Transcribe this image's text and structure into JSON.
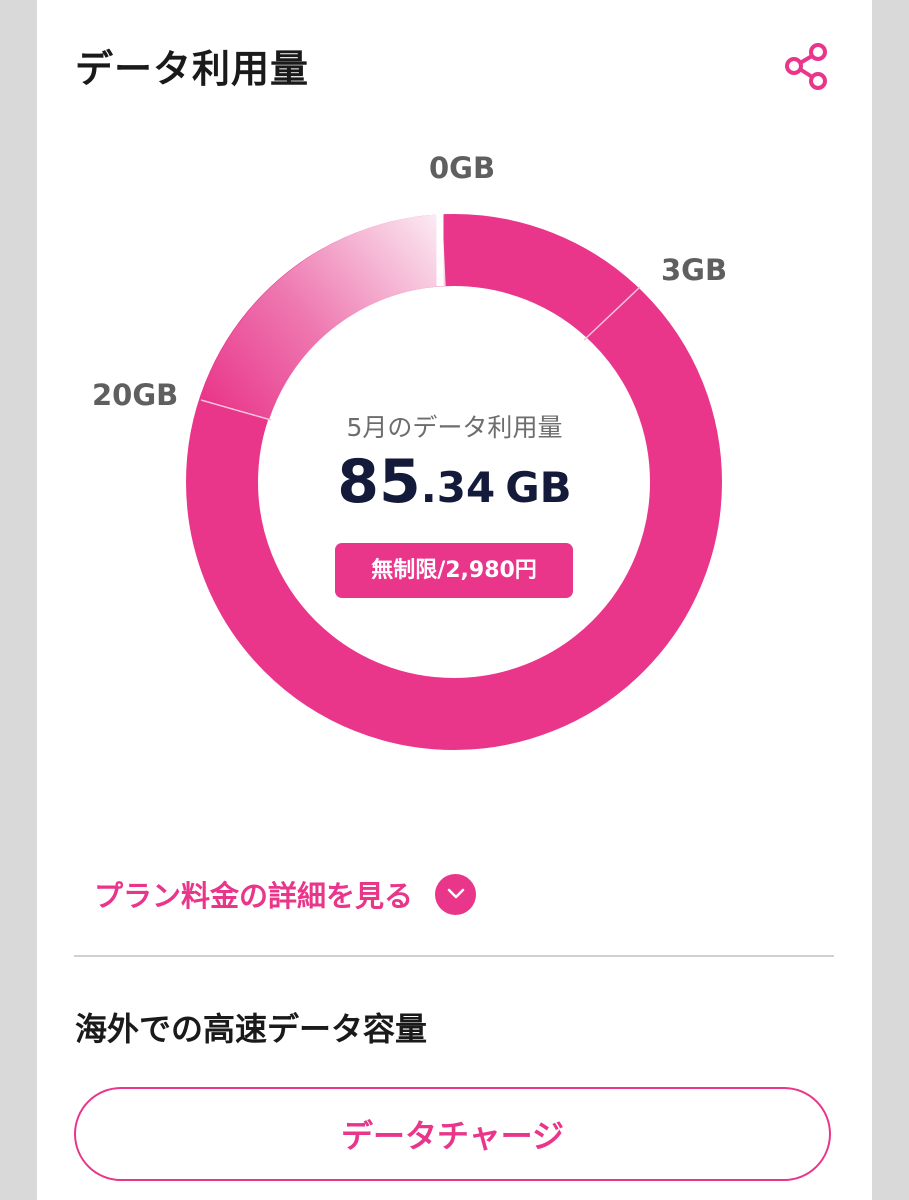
{
  "header": {
    "title": "データ利用量",
    "share_icon": "share-icon"
  },
  "gauge": {
    "ticks": [
      "0GB",
      "3GB",
      "20GB"
    ],
    "caption": "5月のデータ利用量",
    "value_int": "85",
    "value_dec": ".34",
    "unit": "GB",
    "plan_badge": "無制限/2,980円",
    "used_gb": 85.34,
    "accent_color": "#e9358a"
  },
  "plan_details": {
    "label": "プラン料金の詳細を見る",
    "icon": "chevron-down-icon"
  },
  "overseas": {
    "title": "海外での高速データ容量",
    "button_label": "データチャージ"
  },
  "colors": {
    "accent": "#e9358a",
    "text_dark": "#131a3a"
  }
}
